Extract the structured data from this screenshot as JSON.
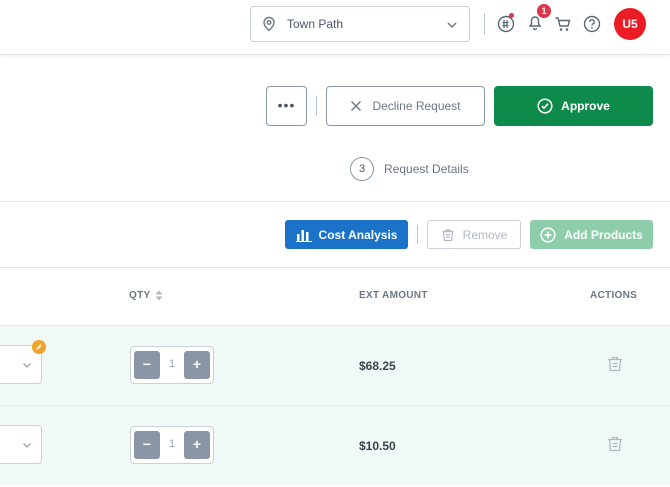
{
  "header": {
    "location_value": "Town Path",
    "notification_count": "1",
    "avatar_initials": "U5"
  },
  "actions": {
    "more_label": "•••",
    "decline_label": "Decline Request",
    "approve_label": "Approve"
  },
  "step": {
    "number": "3",
    "label": "Request Details"
  },
  "toolbar": {
    "cost_analysis_label": "Cost Analysis",
    "remove_label": "Remove",
    "add_products_label": "Add Products"
  },
  "table": {
    "columns": {
      "qty": "QTY",
      "ext_amount": "EXT AMOUNT",
      "actions": "ACTIONS"
    },
    "rows": [
      {
        "qty": "1",
        "ext_amount": "$68.25",
        "decrement": "−",
        "increment": "+"
      },
      {
        "qty": "1",
        "ext_amount": "$10.50",
        "decrement": "−",
        "increment": "+"
      }
    ]
  },
  "colors": {
    "approve": "#0e8a4a",
    "cost_analysis": "#1a73c8",
    "add_products_disabled": "#8dcda9",
    "avatar": "#ec1c24",
    "row_highlight": "#f0f9f6",
    "badge": "#e0344b"
  },
  "icons": [
    "location-pin-icon",
    "chevron-down-icon",
    "currency-icon",
    "bell-icon",
    "cart-icon",
    "help-icon",
    "close-icon",
    "check-circle-icon",
    "bar-chart-icon",
    "trash-icon",
    "plus-circle-icon",
    "sort-icon",
    "edit-icon"
  ]
}
